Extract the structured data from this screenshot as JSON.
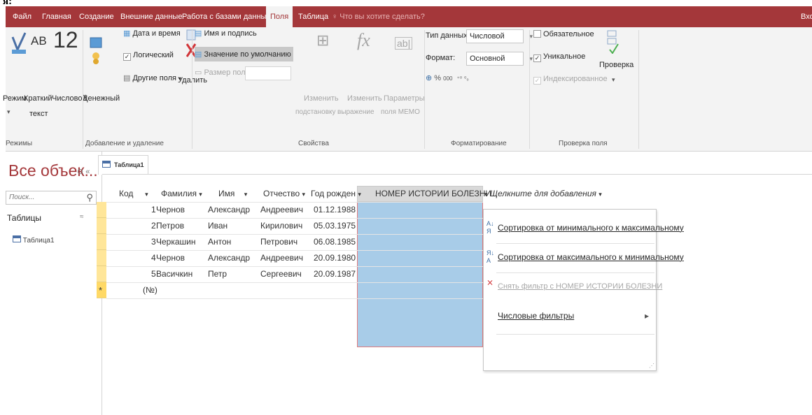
{
  "page_label": "я:",
  "tabs": [
    {
      "label": "Файл"
    },
    {
      "label": "Главная"
    },
    {
      "label": "Создание"
    },
    {
      "label": "Внешние данные"
    },
    {
      "label": "Работа с базами данных"
    },
    {
      "label": "Поля"
    },
    {
      "label": "Таблица"
    }
  ],
  "tell_me": "Что вы хотите сделать?",
  "account": "Вхо",
  "ribbon": {
    "view_btn": "Режим",
    "short_text_btn": "Краткий текст",
    "short_text_line1": "Краткий",
    "short_text_line2": "текст",
    "number_btn": "Числовой",
    "currency_btn": "Денежный",
    "ab_glyph": "AB",
    "twelve_glyph": "12",
    "date_time": "Дата и время",
    "yes_no": "Логический",
    "more_fields": "Другие поля",
    "delete_btn": "Удалить",
    "name_caption": "Имя и подпись",
    "default_value": "Значение по умолчанию",
    "field_size": "Размер поля",
    "modify_lookups_1": "Изменить",
    "modify_lookups_2": "подстановку",
    "modify_expr_1": "Изменить",
    "modify_expr_2": "выражение",
    "memo_1": "Параметры",
    "memo_2": "поля МЕМО",
    "data_type_label": "Тип данных:",
    "data_type_value": "Числовой",
    "format_label": "Формат:",
    "format_value": "Основной",
    "required": "Обязательное",
    "unique": "Уникальное",
    "indexed": "Индексированное",
    "validation_btn": "Проверка",
    "groups": {
      "views": "Режимы",
      "add_delete": "Добавление и удаление",
      "properties": "Свойства",
      "formatting": "Форматирование",
      "field_validation": "Проверка поля"
    }
  },
  "nav": {
    "title": "Все объек...",
    "search_placeholder": "Поиск...",
    "section": "Таблицы",
    "items": [
      {
        "label": "Таблица1"
      }
    ]
  },
  "doc_tab": "Таблица1",
  "table": {
    "headers": [
      "Код",
      "Фамилия",
      "Имя",
      "Отчество",
      "Год рожден",
      "НОМЕР ИСТОРИИ БОЛЕЗНИ",
      "Щелкните для добавления"
    ],
    "rows": [
      {
        "id": "1",
        "last": "Чернов",
        "first": "Александр",
        "patr": "Андреевич",
        "birth": "01.12.1988"
      },
      {
        "id": "2",
        "last": "Петров",
        "first": "Иван",
        "patr": "Кирилович",
        "birth": "05.03.1975"
      },
      {
        "id": "3",
        "last": "Черкашин",
        "first": "Антон",
        "patr": "Петрович",
        "birth": "06.08.1985"
      },
      {
        "id": "4",
        "last": "Чернов",
        "first": "Александр",
        "patr": "Андреевич",
        "birth": "20.09.1980"
      },
      {
        "id": "5",
        "last": "Васичкин",
        "first": "Петр",
        "patr": "Сергеевич",
        "birth": "20.09.1987"
      }
    ],
    "new_row_marker": "*",
    "new_row_id": "(№)"
  },
  "menu": {
    "sort_asc": "Сортировка от минимального к максимальному",
    "sort_desc": "Сортировка от максимального к минимальному",
    "clear_filter": "Снять фильтр с НОМЕР ИСТОРИИ БОЛЕЗНИ",
    "number_filters": "Числовые фильтры"
  },
  "colors": {
    "accent": "#a4373a",
    "selection": "#a8cce8",
    "row_selector": "#ffe699"
  }
}
